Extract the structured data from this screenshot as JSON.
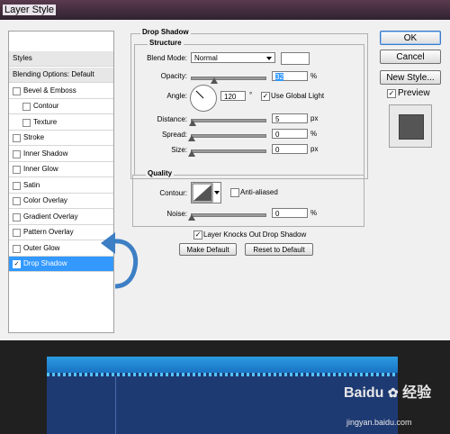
{
  "window": {
    "title": "Layer Style"
  },
  "styles_panel": {
    "items": [
      {
        "label": "Styles",
        "type": "header"
      },
      {
        "label": "Blending Options: Default",
        "type": "header"
      },
      {
        "label": "Bevel & Emboss",
        "checked": false
      },
      {
        "label": "Contour",
        "checked": false,
        "sub": true
      },
      {
        "label": "Texture",
        "checked": false,
        "sub": true
      },
      {
        "label": "Stroke",
        "checked": false
      },
      {
        "label": "Inner Shadow",
        "checked": false
      },
      {
        "label": "Inner Glow",
        "checked": false
      },
      {
        "label": "Satin",
        "checked": false
      },
      {
        "label": "Color Overlay",
        "checked": false
      },
      {
        "label": "Gradient Overlay",
        "checked": false
      },
      {
        "label": "Pattern Overlay",
        "checked": false
      },
      {
        "label": "Outer Glow",
        "checked": false
      },
      {
        "label": "Drop Shadow",
        "checked": true,
        "selected": true
      }
    ]
  },
  "drop_shadow": {
    "title": "Drop Shadow",
    "structure": {
      "legend": "Structure",
      "blend_mode_label": "Blend Mode:",
      "blend_mode_value": "Normal",
      "opacity_label": "Opacity:",
      "opacity_value": "32",
      "opacity_fraction": 0.32,
      "percent": "%",
      "angle_label": "Angle:",
      "angle_value": "120",
      "degree": "°",
      "use_global_light": "Use Global Light",
      "use_global_light_checked": true,
      "distance_label": "Distance:",
      "distance_value": "5",
      "distance_fraction": 0.02,
      "px": "px",
      "spread_label": "Spread:",
      "spread_value": "0",
      "size_label": "Size:",
      "size_value": "0"
    },
    "quality": {
      "legend": "Quality",
      "contour_label": "Contour:",
      "anti_aliased": "Anti-aliased",
      "anti_aliased_checked": false,
      "noise_label": "Noise:",
      "noise_value": "0"
    },
    "layer_knocks_out": "Layer Knocks Out Drop Shadow",
    "layer_knocks_out_checked": true,
    "make_default": "Make Default",
    "reset_to_default": "Reset to Default"
  },
  "buttons": {
    "ok": "OK",
    "cancel": "Cancel",
    "new_style": "New Style...",
    "preview": "Preview",
    "preview_checked": true
  },
  "watermark": {
    "brand": "Baidu",
    "cn": "经验",
    "url": "jingyan.baidu.com"
  },
  "colors": {
    "accent": "#3399ff",
    "selection": "#3399ff",
    "annotation_arrow": "#3d7fc4"
  }
}
